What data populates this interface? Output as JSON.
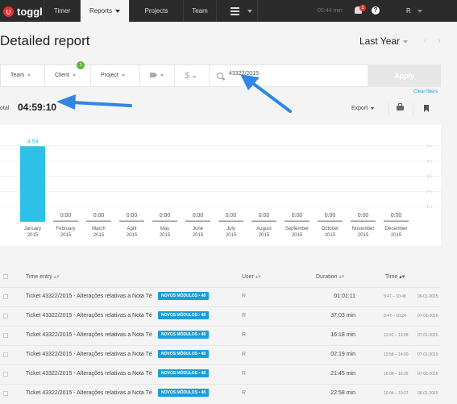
{
  "nav": {
    "logo": "toggl",
    "tabs": [
      "Timer",
      "Reports",
      "Projects",
      "Team"
    ],
    "time": "05:44 min",
    "notifications": "1",
    "help": "?",
    "user": "R"
  },
  "header": {
    "title": "Detailed report",
    "period": "Last Year",
    "period_nav": "‹ ›"
  },
  "filters": {
    "items": [
      "Team",
      "Client",
      "Project",
      "",
      ""
    ],
    "client_badge": "1",
    "search_value": "43322/2015",
    "apply": "Apply",
    "clear": "Clear filters"
  },
  "summary": {
    "total_label": "otal",
    "total_value": "04:59:10",
    "export": "Export"
  },
  "chart_data": {
    "type": "bar",
    "categories": [
      "January 2015",
      "February 2015",
      "March 2015",
      "April 2015",
      "May 2015",
      "June 2015",
      "July 2015",
      "August 2015",
      "September 2015",
      "October 2015",
      "November 2015",
      "December 2015"
    ],
    "values": [
      4.983,
      0,
      0,
      0,
      0,
      0,
      0,
      0,
      0,
      0,
      0,
      0
    ],
    "labels": [
      "4:59",
      "0:00",
      "0:00",
      "0:00",
      "0:00",
      "0:00",
      "0:00",
      "0:00",
      "0:00",
      "0:00",
      "0:00",
      "0:00"
    ],
    "yticks": [
      "5 h",
      "4 h",
      "3 h",
      "2 h",
      "1 h"
    ],
    "ylim": [
      0,
      5
    ],
    "colors": {
      "bar": "#2fc0e8",
      "empty": "#999999"
    }
  },
  "table": {
    "headers": [
      "Time entry",
      "User",
      "Duration",
      "Time"
    ],
    "rows": [
      {
        "desc": "Ticket 43322/2015 - Alterações relativas a Nota Té",
        "tag": "NOVOS MÓDULOS • 48",
        "user": "R",
        "duration": "01:01:11",
        "range": "9:47 – 10:48",
        "date": "06-01-2015"
      },
      {
        "desc": "Ticket 43322/2015 - Alterações relativas a Nota Té",
        "tag": "NOVOS MÓDULOS • 48",
        "user": "R",
        "duration": "37:03 min",
        "range": "9:47 – 10:24",
        "date": "07-01-2015"
      },
      {
        "desc": "Ticket 43322/2015 - Alterações relativas a Nota Té",
        "tag": "NOVOS MÓDULOS • 48",
        "user": "R",
        "duration": "16:18 min",
        "range": "13:41 – 13:58",
        "date": "07-01-2015"
      },
      {
        "desc": "Ticket 43322/2015 - Alterações relativas a Nota Té",
        "tag": "NOVOS MÓDULOS • 48",
        "user": "R",
        "duration": "02:19 min",
        "range": "13:58 – 14:00",
        "date": "07-01-2015"
      },
      {
        "desc": "Ticket 43322/2015 - Alterações relativas a Nota Té",
        "tag": "NOVOS MÓDULOS • 48",
        "user": "R",
        "duration": "21:45 min",
        "range": "16:04 – 16:25",
        "date": "07-01-2015"
      },
      {
        "desc": "Ticket 43322/2015 - Alterações relativas a Nota Té",
        "tag": "NOVOS MÓDULOS • 48",
        "user": "R",
        "duration": "22:58 min",
        "range": "10:04 – 10:27",
        "date": "08-01-2015"
      }
    ]
  },
  "colors": {
    "accent": "#1b9ed6",
    "brand": "#e8302f",
    "annotation": "#2f86e6"
  }
}
